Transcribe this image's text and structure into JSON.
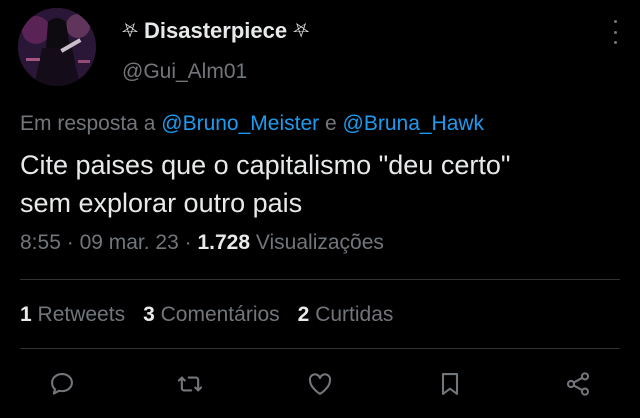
{
  "author": {
    "display_name": "Disasterpiece",
    "name_symbol": "⛧",
    "handle": "@Gui_Alm01"
  },
  "reply": {
    "prefix": "Em resposta a",
    "mention_1": "@Bruno_Meister",
    "joiner": "e",
    "mention_2": "@Bruna_Hawk"
  },
  "tweet": {
    "line_1": "Cite paises que o capitalismo \"deu certo\"",
    "line_2": "sem explorar outro pais"
  },
  "meta": {
    "time": "8:55",
    "sep": "·",
    "date": "09 mar. 23",
    "views_count": "1.728",
    "views_label": "Visualizações"
  },
  "stats": {
    "retweets_count": "1",
    "retweets_label": "Retweets",
    "comments_count": "3",
    "comments_label": "Comentários",
    "likes_count": "2",
    "likes_label": "Curtidas"
  },
  "icons": {
    "reply": "comment-icon",
    "retweet": "retweet-icon",
    "like": "heart-icon",
    "bookmark": "bookmark-icon",
    "share": "share-icon",
    "more": "more-vertical-icon"
  },
  "colors": {
    "background": "#000000",
    "text": "#e7e9ea",
    "muted": "#71767b",
    "link": "#1d9bf0",
    "divider": "#2f3336"
  }
}
